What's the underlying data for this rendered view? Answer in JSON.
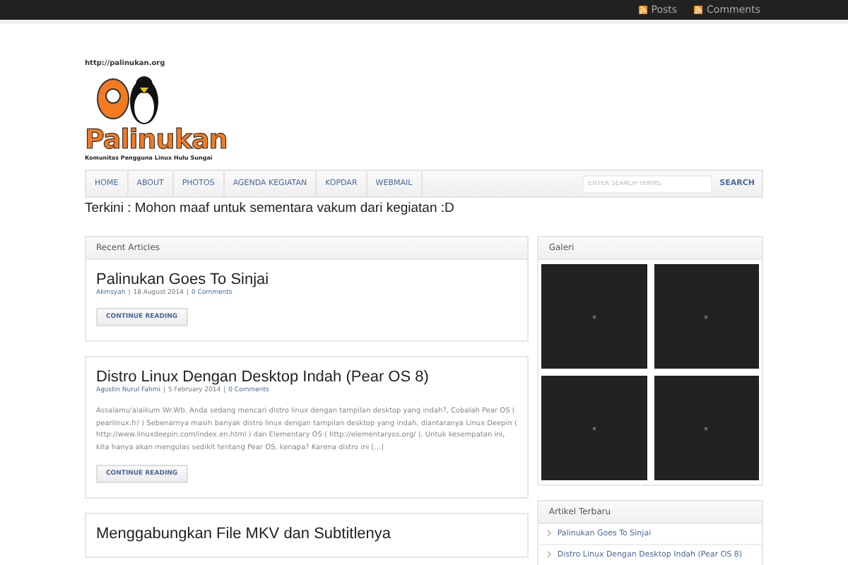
{
  "top_links": [
    {
      "label": "Posts"
    },
    {
      "label": "Comments"
    }
  ],
  "logo": {
    "url": "http://palinukan.org",
    "name": "Palinukan",
    "tagline": "Komunitas Pengguna Linux Hulu Sungai"
  },
  "nav": {
    "items": [
      {
        "label": "HOME"
      },
      {
        "label": "ABOUT"
      },
      {
        "label": "PHOTOS"
      },
      {
        "label": "AGENDA KEGIATAN"
      },
      {
        "label": "KOPDAR"
      },
      {
        "label": "WEBMAIL"
      }
    ],
    "search": {
      "placeholder": "ENTER SEARCH TERMS",
      "button": "SEARCH"
    }
  },
  "ticker": "Terkini : Mohon maaf untuk sementara vakum dari kegiatan :D",
  "recent": {
    "title": "Recent Articles",
    "separator": "|",
    "posts": [
      {
        "title": "Palinukan Goes To Sinjai",
        "author": "Akmsyah",
        "date": "18 August 2014",
        "comments": "0 Comments",
        "button": "CONTINUE READING"
      },
      {
        "title": "Distro Linux Dengan Desktop Indah (Pear OS 8)",
        "author": "Agustin Nurul Fahmi",
        "date": "5 February 2014",
        "comments": "0 Comments",
        "excerpt": "Assalamu'alaikum Wr.Wb. Anda sedang mencari distro linux dengan tampilan desktop yang indah?, Cobalah Pear OS ( pearlinux.fr/ ) Sebenarnya masih banyak distro linux dengan tampilan desktop yang indah, diantaranya Linux Deepin ( http://www.linuxdeepin.com/index.en.html ) dan Elementary OS ( http://elementaryos.org/ ). Untuk kesempatan ini, kita hanya akan mengulas sedikit tentang Pear OS, kenapa? Karena distro ini [...]",
        "button": "CONTINUE READING"
      },
      {
        "title": "Menggabungkan File MKV dan Subtitlenya"
      }
    ]
  },
  "sidebar": {
    "gallery": {
      "title": "Galeri",
      "thumbnails": [
        {
          "kind": "loading"
        },
        {
          "kind": "loading"
        },
        {
          "kind": "loading"
        },
        {
          "kind": "loading"
        }
      ]
    },
    "latest": {
      "title": "Artikel Terbaru",
      "items": [
        {
          "label": "Palinukan Goes To Sinjai"
        },
        {
          "label": "Distro Linux Dengan Desktop Indah (Pear OS 8)"
        }
      ]
    }
  }
}
